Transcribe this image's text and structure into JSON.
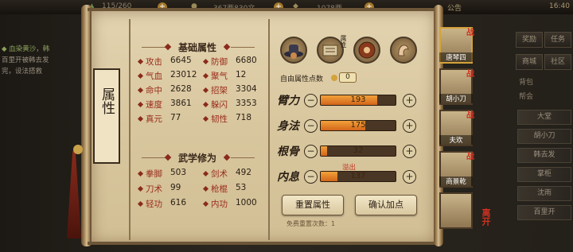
{
  "topbar": {
    "stamina": "115/260",
    "coins": "367两830文",
    "silver": "1078两",
    "notice": "公告",
    "time": "16:40"
  },
  "quest": {
    "title": "◆ 血染黄沙，韩",
    "desc": "百里开被韩去发\n完，设法搭救"
  },
  "right_menu": {
    "top_buttons": [
      "奖励",
      "任务",
      "商城",
      "社区"
    ],
    "labels": [
      "背包",
      "帮会"
    ],
    "team_list": [
      "大堂",
      "胡小刀",
      "韩去发",
      "掌柜",
      "沈雨",
      "百里开"
    ]
  },
  "scroll_title": "属性",
  "basic": {
    "title": "基础属性",
    "stats": [
      {
        "l1": "攻击",
        "v1": "6645",
        "l2": "防御",
        "v2": "6680"
      },
      {
        "l1": "气血",
        "v1": "23012",
        "l2": "聚气",
        "v2": "12"
      },
      {
        "l1": "命中",
        "v1": "2628",
        "l2": "招架",
        "v2": "3304"
      },
      {
        "l1": "速度",
        "v1": "3861",
        "l2": "躲闪",
        "v2": "3353"
      },
      {
        "l1": "真元",
        "v1": "77",
        "l2": "韧性",
        "v2": "718"
      }
    ]
  },
  "martial": {
    "title": "武学修为",
    "stats": [
      {
        "l1": "拳脚",
        "v1": "503",
        "l2": "剑术",
        "v2": "492"
      },
      {
        "l1": "刀术",
        "v1": "99",
        "l2": "枪棍",
        "v2": "53"
      },
      {
        "l1": "轻功",
        "v1": "616",
        "l2": "内功",
        "v2": "1000"
      }
    ]
  },
  "attr_icons": [
    "hat-icon",
    "attribute-scroll-icon",
    "eye-icon",
    "muscle-icon"
  ],
  "icon_badge": "属性",
  "free_points": {
    "label": "自由属性点数",
    "value": "0"
  },
  "bars": [
    {
      "label": "臂力",
      "value": "193",
      "fill": 0.76
    },
    {
      "label": "身法",
      "value": "175",
      "fill": 0.6
    },
    {
      "label": "根骨",
      "value": "32",
      "fill": 0.09
    },
    {
      "label": "内息",
      "value": "137",
      "fill": 0.22,
      "note": "溢出"
    }
  ],
  "buttons": {
    "reset": "重置属性",
    "confirm": "确认加点"
  },
  "reset_note": "免费重置次数：1",
  "portraits": [
    {
      "name": "唐琴四",
      "badge": "战"
    },
    {
      "name": "胡小刀",
      "badge": "战"
    },
    {
      "name": "夫欢",
      "badge": "战"
    },
    {
      "name": "商景乾",
      "badge": "战"
    },
    {
      "name": "",
      "badge": ""
    }
  ],
  "corner_badge": "离开",
  "colors": {
    "accent": "#9a2c1c",
    "bar": "#e88a2a",
    "parchment": "#ddcba3"
  }
}
